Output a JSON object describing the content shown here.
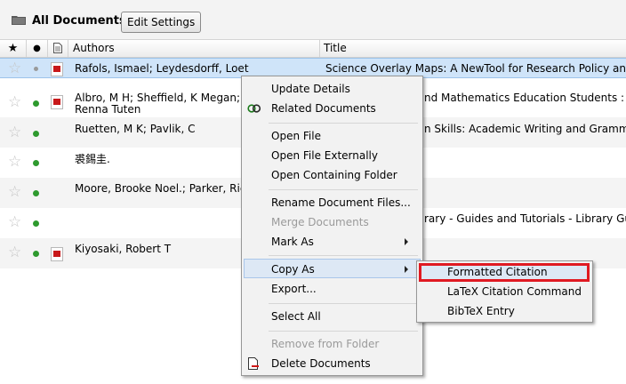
{
  "toolbar": {
    "title": "All Documents",
    "edit_settings": "Edit Settings",
    "icon": "folder-icon"
  },
  "columns": {
    "star": "★",
    "read": "●",
    "file": "file-icon",
    "authors": "Authors",
    "title": "Title"
  },
  "rows": [
    {
      "authors": "Rafols, Ismael; Leydesdorff, Loet",
      "title": "Science Overlay Maps: A NewTool for Research Policy and Library Man",
      "selected": true,
      "pdf": true
    },
    {
      "authors": "Albro, M H; Sheffield, K Megan; Grant,",
      "authors2": "Renna Tuten",
      "title": "nd Mathematics Education Students : A Case Stu",
      "pdf": true
    },
    {
      "authors": "Ruetten, M K; Pavlik, C",
      "title": "n Skills: Academic Writing and Grammar",
      "pdf": false
    },
    {
      "authors": "裘錫圭.",
      "title": "",
      "pdf": false
    },
    {
      "authors": "Moore, Brooke Noel.; Parker, Richard",
      "title": "",
      "pdf": false
    },
    {
      "authors": "",
      "title": "rary - Guides and Tutorials - Library Guides &am",
      "pdf": false
    },
    {
      "authors": "Kiyosaki, Robert T",
      "title": "",
      "pdf": true
    }
  ],
  "context_menu": {
    "update_details": "Update Details",
    "related_documents": "Related Documents",
    "open_file": "Open File",
    "open_file_externally": "Open File Externally",
    "open_containing_folder": "Open Containing Folder",
    "rename_document_files": "Rename Document Files...",
    "merge_documents": "Merge Documents",
    "mark_as": "Mark As",
    "copy_as": "Copy As",
    "export": "Export...",
    "select_all": "Select All",
    "remove_from_folder": "Remove from Folder",
    "delete_documents": "Delete Documents"
  },
  "submenu": {
    "formatted_citation": "Formatted Citation",
    "latex_citation_command": "LaTeX Citation Command",
    "bibtex_entry": "BibTeX Entry"
  },
  "colors": {
    "selection": "#cfe4f9",
    "highlight_border": "#e01a22",
    "read_dot": "#2e9a2e",
    "pdf_red": "#c8181a"
  }
}
